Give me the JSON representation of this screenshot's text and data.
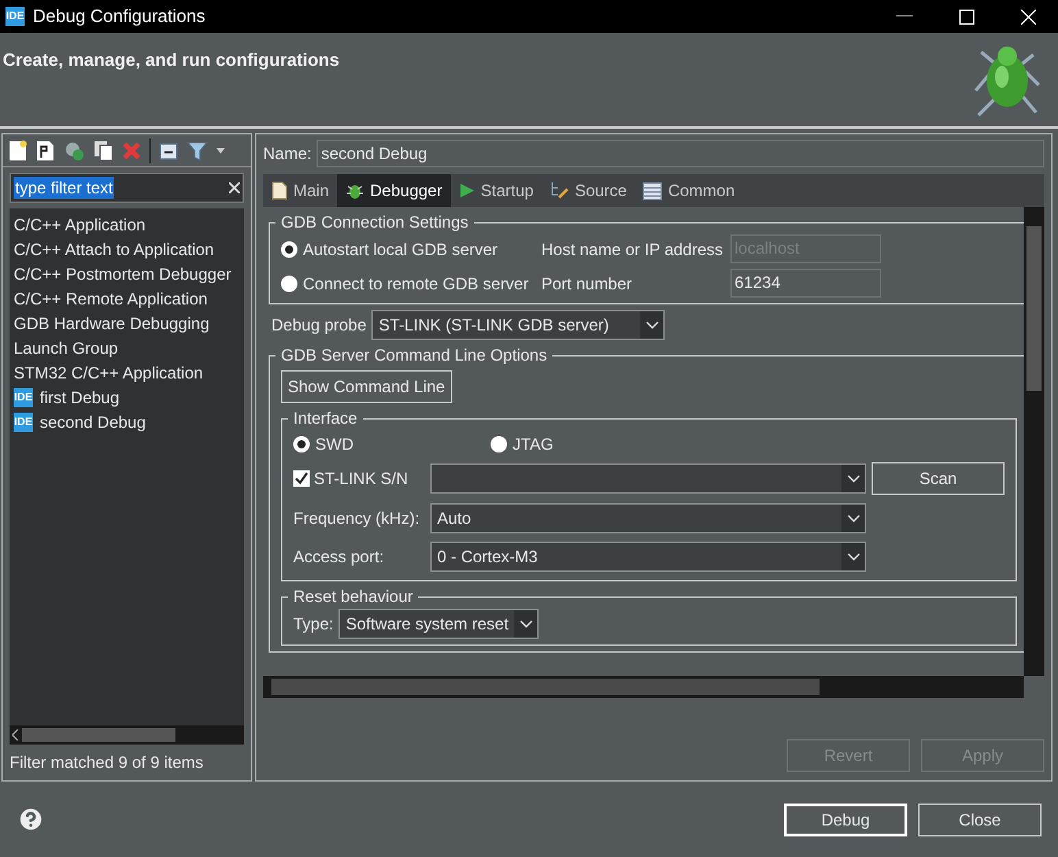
{
  "window": {
    "title": "Debug Configurations",
    "app_badge": "IDE"
  },
  "header": {
    "title": "Create, manage, and run configurations"
  },
  "filter": {
    "value": "type filter text"
  },
  "configs": [
    {
      "label": "C/C++ Application",
      "kind": "type"
    },
    {
      "label": "C/C++ Attach to Application",
      "kind": "type"
    },
    {
      "label": "C/C++ Postmortem Debugger",
      "kind": "type"
    },
    {
      "label": "C/C++ Remote Application",
      "kind": "type"
    },
    {
      "label": "GDB Hardware Debugging",
      "kind": "type"
    },
    {
      "label": "Launch Group",
      "kind": "type"
    },
    {
      "label": "STM32 C/C++ Application",
      "kind": "type"
    },
    {
      "label": "first Debug",
      "kind": "config",
      "badge": "IDE"
    },
    {
      "label": "second Debug",
      "kind": "config",
      "badge": "IDE"
    }
  ],
  "filter_status": "Filter matched 9 of 9 items",
  "name": {
    "label": "Name:",
    "value": "second Debug"
  },
  "tabs": [
    {
      "label": "Main",
      "kind": "file",
      "selected": false
    },
    {
      "label": "Debugger",
      "kind": "bug",
      "selected": true
    },
    {
      "label": "Startup",
      "kind": "play",
      "selected": false
    },
    {
      "label": "Source",
      "kind": "source",
      "selected": false
    },
    {
      "label": "Common",
      "kind": "table",
      "selected": false
    }
  ],
  "gdb_connection": {
    "title": "GDB Connection Settings",
    "modes": [
      {
        "label": "Autostart local GDB server",
        "selected": true
      },
      {
        "label": "Connect to remote GDB server",
        "selected": false
      }
    ],
    "host": {
      "label": "Host name or IP address",
      "value": "localhost",
      "disabled": true
    },
    "port": {
      "label": "Port number",
      "value": "61234",
      "disabled": false
    }
  },
  "debug_probe": {
    "label": "Debug probe",
    "value": "ST-LINK (ST-LINK GDB server)"
  },
  "server_options": {
    "title": "GDB Server Command Line Options",
    "show_button": "Show Command Line",
    "interface": {
      "title": "Interface",
      "protocols": [
        {
          "label": "SWD",
          "selected": true
        },
        {
          "label": "JTAG",
          "selected": false
        }
      ],
      "serial": {
        "label": "ST-LINK S/N",
        "checked": true
      },
      "scan": "Scan",
      "frequency": {
        "label": "Frequency (kHz):",
        "value": "Auto"
      },
      "access_port": {
        "label": "Access port:",
        "value": "0 - Cortex-M3"
      }
    },
    "reset": {
      "title": "Reset behaviour",
      "type_label": "Type:",
      "type_value": "Software system reset"
    }
  },
  "actions": [
    {
      "label": "Revert",
      "disabled": true
    },
    {
      "label": "Apply",
      "disabled": true
    }
  ],
  "buttons": [
    {
      "label": "Debug",
      "default": true
    },
    {
      "label": "Close",
      "default": false
    }
  ]
}
